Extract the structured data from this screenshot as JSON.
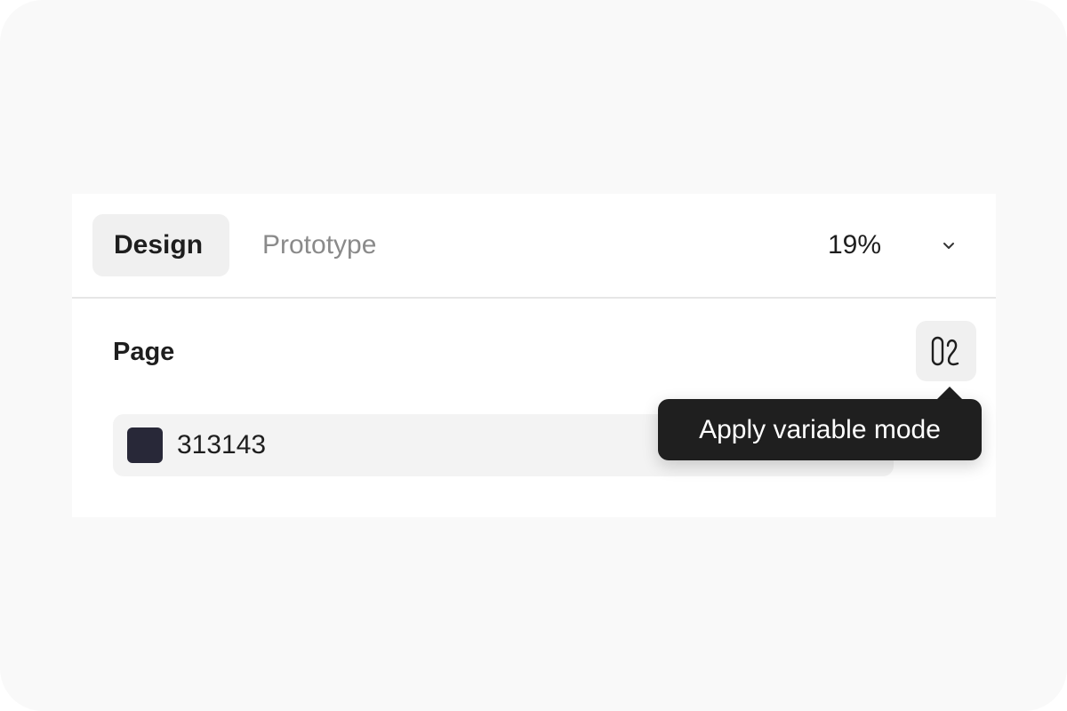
{
  "tabs": {
    "design_label": "Design",
    "prototype_label": "Prototype",
    "active": "Design"
  },
  "zoom": {
    "value": "19%",
    "chevron_icon": "chevron-down-icon"
  },
  "section": {
    "title": "Page",
    "mode_button_icon": "variable-mode-icon"
  },
  "fill": {
    "hex": "313143",
    "swatch_color": "#282838"
  },
  "tooltip": {
    "text": "Apply variable mode"
  }
}
